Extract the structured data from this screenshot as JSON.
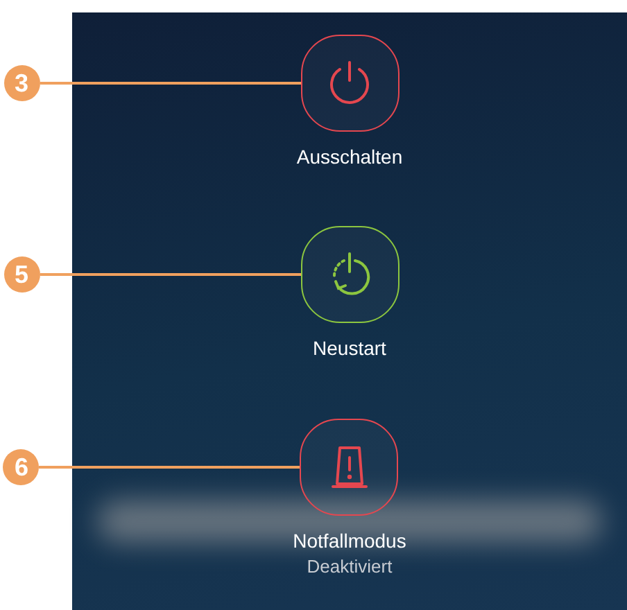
{
  "menu_items": [
    {
      "kind": "power",
      "label": "Ausschalten",
      "callout": "3"
    },
    {
      "kind": "restart",
      "label": "Neustart",
      "callout": "5"
    },
    {
      "kind": "emergency",
      "label": "Notfallmodus",
      "status": "Deaktiviert",
      "callout": "6"
    }
  ]
}
